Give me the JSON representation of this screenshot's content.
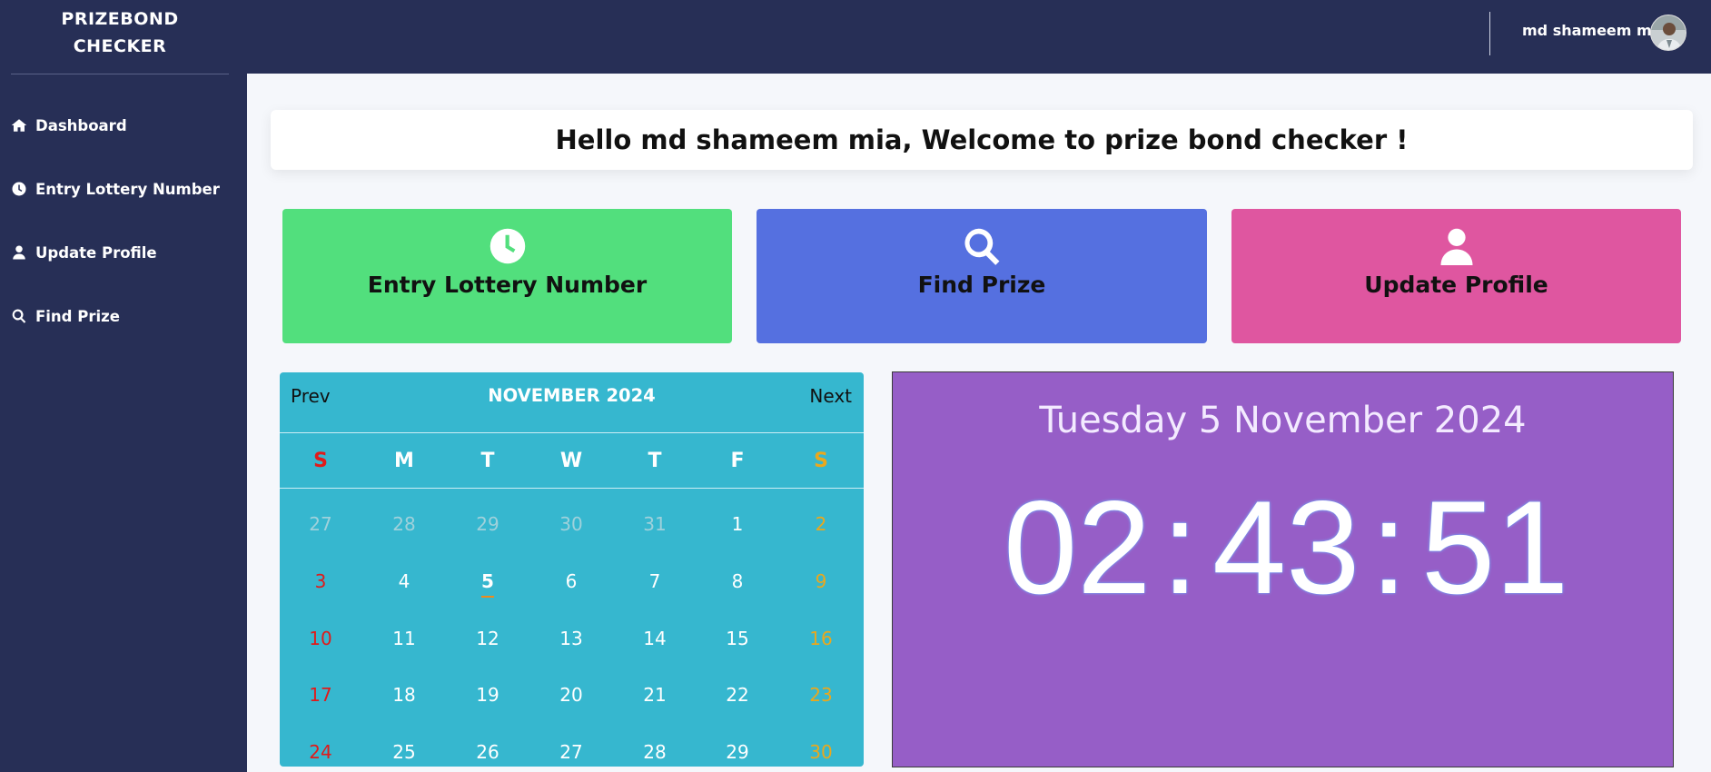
{
  "app": {
    "brand_line1": "PRIZEBOND",
    "brand_line2": "CHECKER"
  },
  "sidebar": {
    "items": [
      {
        "label": "Dashboard",
        "icon": "home-icon"
      },
      {
        "label": "Entry Lottery Number",
        "icon": "clock-icon"
      },
      {
        "label": "Update Profile",
        "icon": "user-icon"
      },
      {
        "label": "Find Prize",
        "icon": "search-icon"
      }
    ]
  },
  "header": {
    "user_name": "md shameem mia",
    "avatar": "user-avatar"
  },
  "welcome": {
    "text": "Hello md shameem mia, Welcome to prize bond checker !"
  },
  "cards": [
    {
      "label": "Entry Lottery Number",
      "icon": "clock-icon",
      "color": "#52df7d"
    },
    {
      "label": "Find Prize",
      "icon": "search-icon",
      "color": "#5570e0"
    },
    {
      "label": "Update Profile",
      "icon": "user-icon",
      "color": "#df56a0"
    }
  ],
  "calendar": {
    "prev_label": "Prev",
    "next_label": "Next",
    "month_label": "NOVEMBER 2024",
    "weekdays": [
      "S",
      "M",
      "T",
      "W",
      "T",
      "F",
      "S"
    ],
    "weeks": [
      [
        "27",
        "28",
        "29",
        "30",
        "31",
        "1",
        "2"
      ],
      [
        "3",
        "4",
        "5",
        "6",
        "7",
        "8",
        "9"
      ],
      [
        "10",
        "11",
        "12",
        "13",
        "14",
        "15",
        "16"
      ],
      [
        "17",
        "18",
        "19",
        "20",
        "21",
        "22",
        "23"
      ],
      [
        "24",
        "25",
        "26",
        "27",
        "28",
        "29",
        "30"
      ]
    ],
    "today": "5",
    "colors": {
      "sunday": "#e01b1b",
      "saturday": "#eaa81d",
      "background": "#36b7cf"
    }
  },
  "clock": {
    "date_text": "Tuesday 5 November 2024",
    "hours": "02",
    "minutes": "43",
    "seconds": "51",
    "separator": ":",
    "background": "#965ec7"
  }
}
